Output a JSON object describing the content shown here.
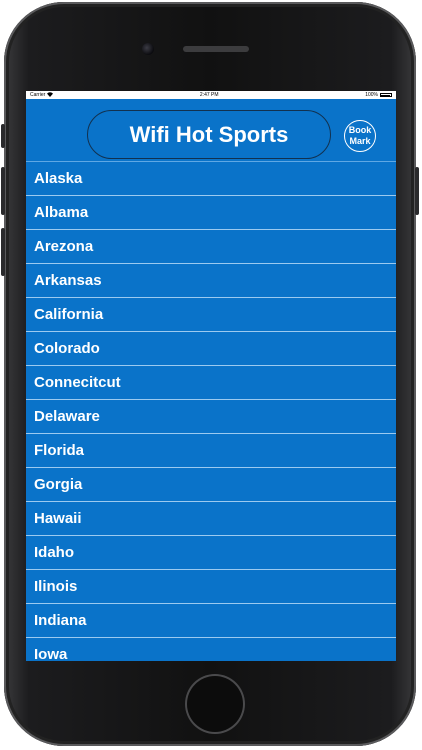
{
  "status_bar": {
    "carrier": "Carrier",
    "time": "2:47 PM",
    "battery": "100%"
  },
  "header": {
    "title": "Wifi Hot Sports",
    "bookmark_line1": "Book",
    "bookmark_line2": "Mark"
  },
  "states": [
    "Alaska",
    "Albama",
    "Arezona",
    "Arkansas",
    "California",
    "Colorado",
    "Connecitcut",
    "Delaware",
    "Florida",
    "Gorgia",
    "Hawaii",
    "Idaho",
    "Ilinois",
    "Indiana",
    "Iowa"
  ],
  "colors": {
    "list_background": "#0a73c9",
    "text": "#ffffff"
  }
}
